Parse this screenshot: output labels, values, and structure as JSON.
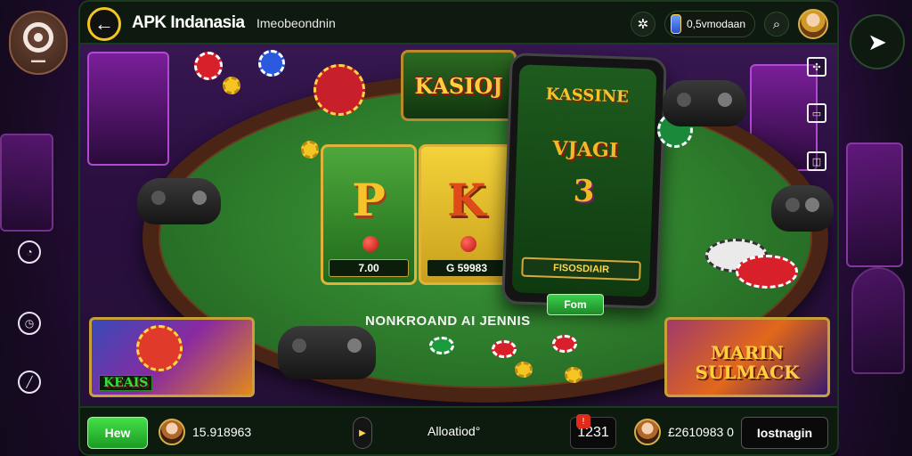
{
  "header": {
    "title": "APK Indanasia",
    "subtitle": "Imeobeondnin",
    "balance": "0,5vmodaan"
  },
  "table": {
    "sign_text": "KASIOJ",
    "slots": [
      {
        "letter": "P",
        "readout": "7.00"
      },
      {
        "letter": "K",
        "readout": "G 59983"
      }
    ],
    "felt_text": "NONKROAND AI JENNIS"
  },
  "phone": {
    "title": "KASSINE",
    "mid": "VJAGI",
    "number": "3",
    "bar": "FISOSDIAIR",
    "button": "Fom"
  },
  "cards": {
    "left_label": "KEAIS",
    "right_label": "MARIN SULMACK"
  },
  "bottombar": {
    "new_button": "Hew",
    "user1_value": "15.918963",
    "center_label": "Alloatiod°",
    "counter": "1231",
    "counter_badge": "!",
    "user2_value": "£2610983 0",
    "login_button": "Iostnagin"
  },
  "icons": {
    "back": "back-arrow-icon",
    "settings": "settings-gear-icon",
    "search": "search-icon",
    "nav": "location-arrow-icon"
  },
  "colors": {
    "accent_green": "#2fc43a",
    "gold": "#f3c623",
    "felt": "#2e7d2c"
  }
}
